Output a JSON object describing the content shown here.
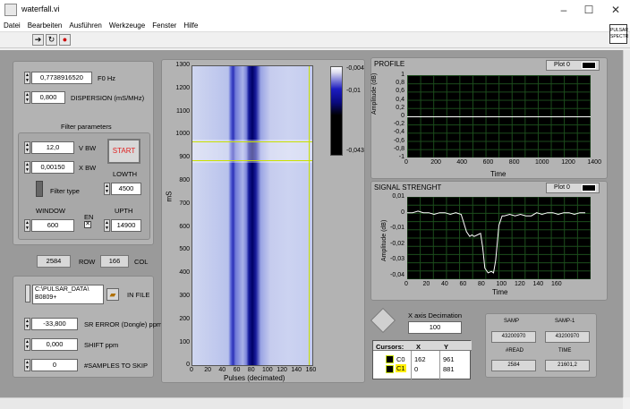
{
  "window": {
    "title": "waterfall.vi",
    "minimize": "–",
    "maximize": "☐",
    "close": "✕"
  },
  "menu": [
    "Datei",
    "Bearbeiten",
    "Ausführen",
    "Werkzeuge",
    "Fenster",
    "Hilfe"
  ],
  "corner_badge": "PULSAR SPECTR",
  "controls": {
    "f0": {
      "value": "0,7738916520",
      "label": "F0 Hz"
    },
    "dispersion": {
      "value": "0,800",
      "label": "DISPERSION (mS/MHz)"
    },
    "filter_title": "Filter parameters",
    "vbw": {
      "value": "12,0",
      "label": "V BW"
    },
    "xbw": {
      "value": "0,00150",
      "label": "X BW"
    },
    "start": "START",
    "lowth_label": "LOWTH",
    "lowth": "4500",
    "filter_type": "Filter type",
    "window_label": "WINDOW",
    "window": "600",
    "en_label": "EN",
    "upth_label": "UPTH",
    "upth": "14900",
    "row": {
      "value": "2584",
      "label": "ROW"
    },
    "col": {
      "value": "166",
      "label": "COL"
    },
    "infile": {
      "value1": "C:\\PULSAR_DATA\\",
      "value2": "B0809+",
      "label": "IN FILE"
    },
    "sr_error": {
      "value": "-33,800",
      "label": "SR ERROR (Dongle) ppm"
    },
    "shift": {
      "value": "0,000",
      "label": "SHIFT ppm"
    },
    "skip": {
      "value": "0",
      "label": "#SAMPLES TO SKIP"
    }
  },
  "waterfall": {
    "ylabel": "mS",
    "xlabel": "Pulses (decimated)",
    "yticks": [
      "1300",
      "1200",
      "1100",
      "1000",
      "900",
      "800",
      "700",
      "600",
      "500",
      "400",
      "300",
      "200",
      "100",
      "0"
    ],
    "xticks": [
      "0",
      "20",
      "40",
      "60",
      "80",
      "100",
      "120",
      "140",
      "160"
    ],
    "colorbar": [
      "-0,004",
      "-0,01",
      "-0,043"
    ]
  },
  "profile": {
    "title": "PROFILE",
    "plot": "Plot 0",
    "ylabel": "Amplitude (dB)",
    "xlabel": "Time",
    "yticks": [
      "1",
      "0,8",
      "0,6",
      "0,4",
      "0,2",
      "0",
      "-0,2",
      "-0,4",
      "-0,6",
      "-0,8",
      "-1"
    ],
    "xticks": [
      "0",
      "200",
      "400",
      "600",
      "800",
      "1000",
      "1200",
      "1400"
    ]
  },
  "signal": {
    "title": "SIGNAL STRENGHT",
    "plot": "Plot 0",
    "ylabel": "Amplitude (dB)",
    "xlabel": "Time",
    "yticks": [
      "0,01",
      "0",
      "-0,01",
      "-0,02",
      "-0,03",
      "-0,04"
    ],
    "xticks": [
      "0",
      "20",
      "40",
      "60",
      "80",
      "100",
      "120",
      "140",
      "160"
    ]
  },
  "chart_data": {
    "type": "line",
    "title": "SIGNAL STRENGHT",
    "xlabel": "Time",
    "ylabel": "Amplitude (dB)",
    "xlim": [
      0,
      170
    ],
    "ylim": [
      -0.042,
      0.01
    ],
    "series": [
      {
        "name": "Plot 0",
        "x": [
          0,
          5,
          10,
          15,
          20,
          25,
          30,
          35,
          40,
          45,
          50,
          55,
          58,
          60,
          62,
          65,
          68,
          70,
          72,
          75,
          78,
          80,
          82,
          85,
          88,
          90,
          95,
          100,
          105,
          110,
          115,
          120,
          125,
          130,
          135,
          140,
          145,
          150,
          155,
          160,
          165
        ],
        "values": [
          0,
          0,
          0.001,
          0,
          0,
          -0.001,
          0,
          0,
          -0.001,
          0,
          -0.001,
          -0.012,
          -0.015,
          -0.014,
          -0.015,
          -0.014,
          -0.013,
          -0.022,
          -0.035,
          -0.038,
          -0.037,
          -0.038,
          -0.03,
          -0.008,
          -0.002,
          -0.002,
          -0.001,
          -0.002,
          -0.001,
          -0.002,
          -0.002,
          0,
          -0.001,
          0,
          0,
          -0.001,
          0,
          0,
          -0.001,
          0,
          0
        ]
      }
    ]
  },
  "decimation": {
    "label": "X axis Decimation",
    "value": "100"
  },
  "cursors": {
    "header": [
      "Cursors:",
      "X",
      "Y"
    ],
    "rows": [
      [
        "C0",
        "162",
        "961"
      ],
      [
        "C1",
        "0",
        "881"
      ]
    ]
  },
  "stats": {
    "samp_label": "SAMP",
    "samp": "43200970",
    "samp1_label": "SAMP-1",
    "samp1": "43200970",
    "read_label": "#READ",
    "read": "2584",
    "time_label": "TIME",
    "time": "21601,2"
  }
}
